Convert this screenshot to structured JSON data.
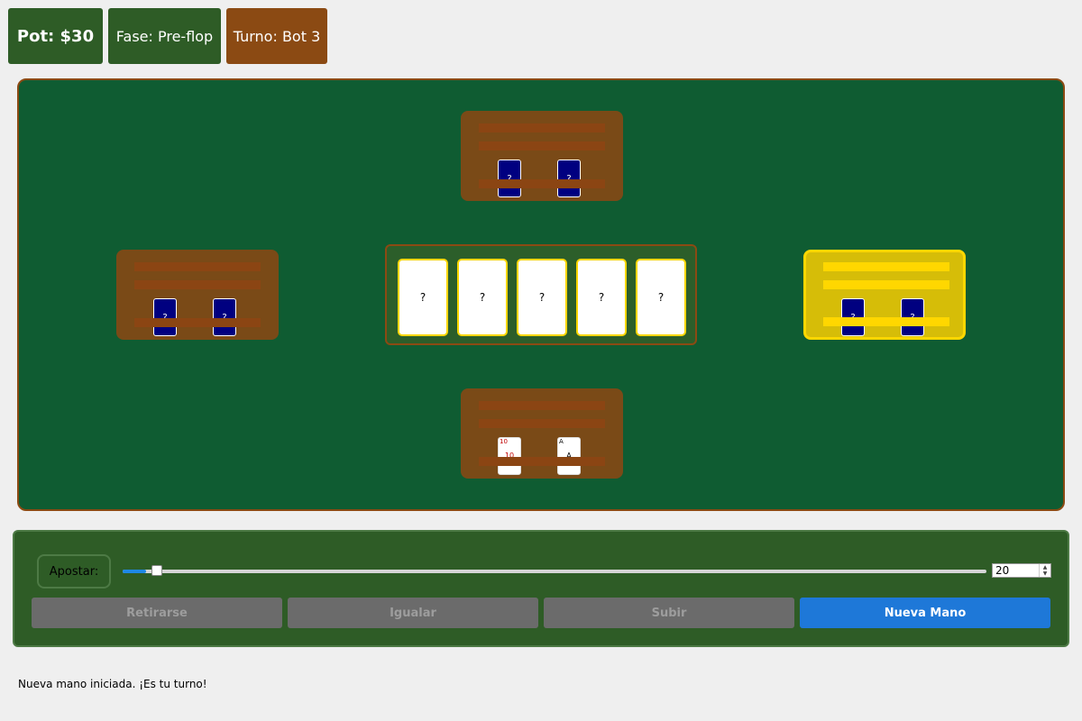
{
  "hud": {
    "pot": "Pot: $30",
    "phase": "Fase: Pre-flop",
    "turn": "Turno: Bot 3"
  },
  "seats": {
    "top": {
      "cards": [
        "?",
        "?"
      ],
      "active": false
    },
    "left": {
      "cards": [
        "?",
        "?"
      ],
      "active": false
    },
    "right": {
      "cards": [
        "?",
        "?"
      ],
      "active": true
    },
    "bottom": {
      "cards": [
        {
          "rank": "10",
          "color": "red"
        },
        {
          "rank": "A",
          "color": "black"
        }
      ],
      "active": false
    }
  },
  "community": {
    "cards": [
      "?",
      "?",
      "?",
      "?",
      "?"
    ]
  },
  "controls": {
    "bet_label": "Apostar:",
    "bet_value": "20",
    "slider_fraction": 0.027,
    "buttons": {
      "fold": "Retirarse",
      "call": "Igualar",
      "raise": "Subir",
      "new_hand": "Nueva Mano"
    }
  },
  "status_message": "Nueva mano iniciada. ¡Es tu turno!",
  "colors": {
    "table_felt": "#0f5c32",
    "wood_border": "#8b4a13",
    "active_seat": "#ffd700",
    "card_back": "#000080",
    "primary_button": "#1e78d8"
  }
}
